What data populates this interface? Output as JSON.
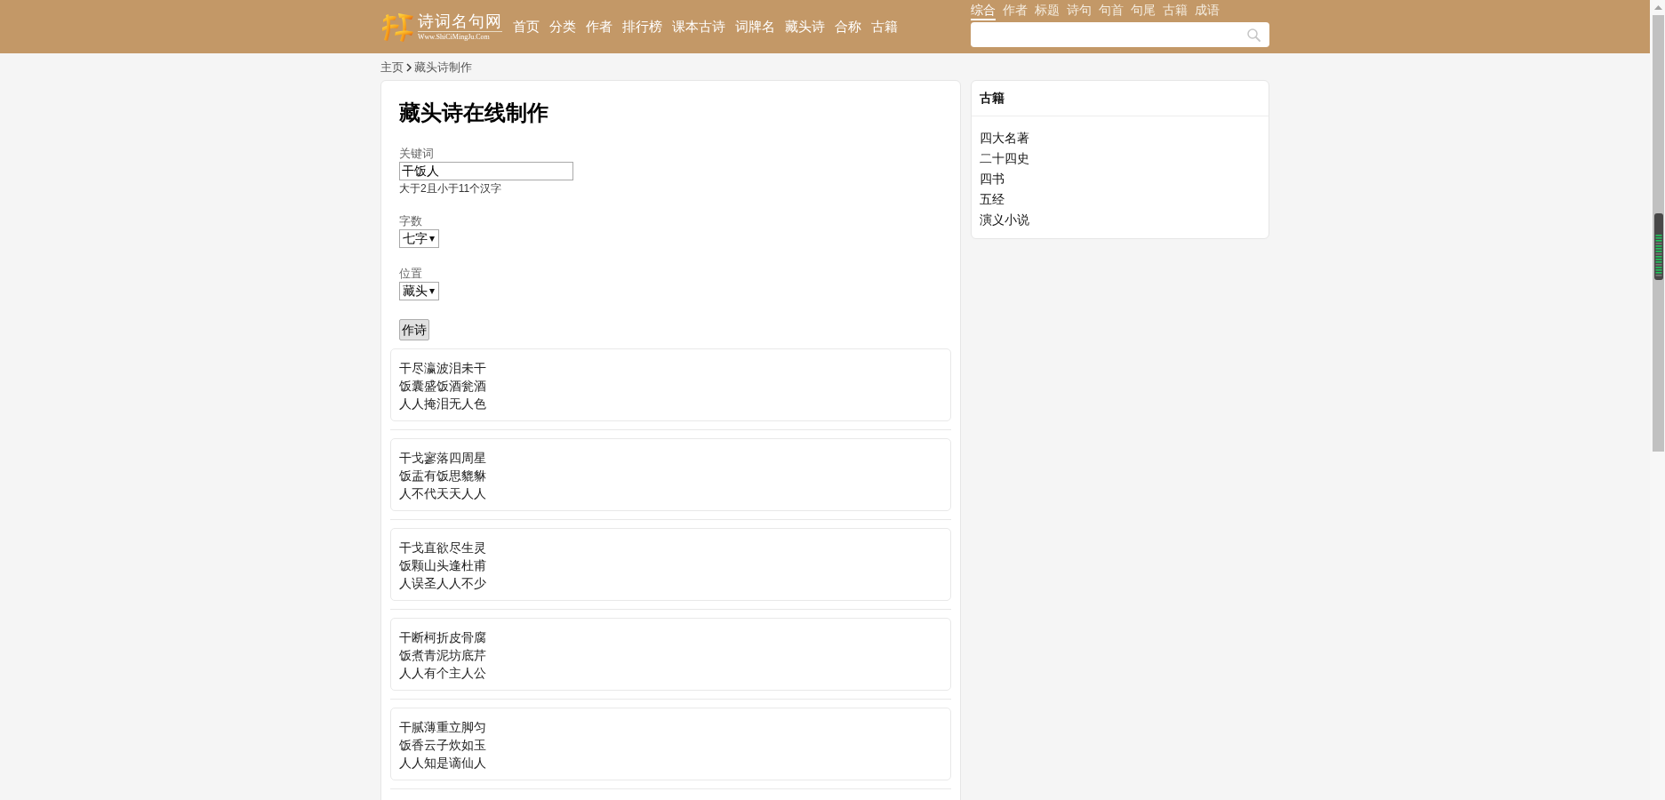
{
  "header": {
    "logo": {
      "title": "诗词名句网",
      "url": "Www.ShiCiMingJu.Com"
    },
    "nav": [
      "首页",
      "分类",
      "作者",
      "排行榜",
      "课本古诗",
      "词牌名",
      "藏头诗",
      "合称",
      "古籍"
    ],
    "search_tabs": [
      {
        "label": "综合",
        "selected": true
      },
      {
        "label": "作者",
        "selected": false
      },
      {
        "label": "标题",
        "selected": false
      },
      {
        "label": "诗句",
        "selected": false
      },
      {
        "label": "句首",
        "selected": false
      },
      {
        "label": "句尾",
        "selected": false
      },
      {
        "label": "古籍",
        "selected": false
      },
      {
        "label": "成语",
        "selected": false
      }
    ]
  },
  "breadcrumb": [
    "主页",
    "藏头诗制作"
  ],
  "main": {
    "title": "藏头诗在线制作",
    "fields": [
      {
        "kind": "text",
        "label": "关键词",
        "value": "干饭人",
        "hint": "大于2且小于11个汉字"
      },
      {
        "kind": "select",
        "label": "字数",
        "value": "七字"
      },
      {
        "kind": "select",
        "label": "位置",
        "value": "藏头"
      }
    ],
    "submit": "作诗",
    "poems": [
      {
        "lines": [
          "干尽瀛波泪未干",
          "饭囊盛饭酒瓮酒",
          "人人掩泪无人色"
        ]
      },
      {
        "lines": [
          "干戈寥落四周星",
          "饭盂有饭思貔貅",
          "人不代天天人人"
        ]
      },
      {
        "lines": [
          "干戈直欲尽生灵",
          "饭颗山头逢杜甫",
          "人误圣人人不少"
        ]
      },
      {
        "lines": [
          "干断柯折皮骨腐",
          "饭煮青泥坊底芹",
          "人人有个主人公"
        ]
      },
      {
        "lines": [
          "干腻薄重立脚匀",
          "饭香云子炊如玉",
          "人人知是谪仙人"
        ]
      }
    ]
  },
  "sidebar": {
    "title": "古籍",
    "items": [
      "四大名著",
      "二十四史",
      "四书",
      "五经",
      "演义小说"
    ]
  }
}
